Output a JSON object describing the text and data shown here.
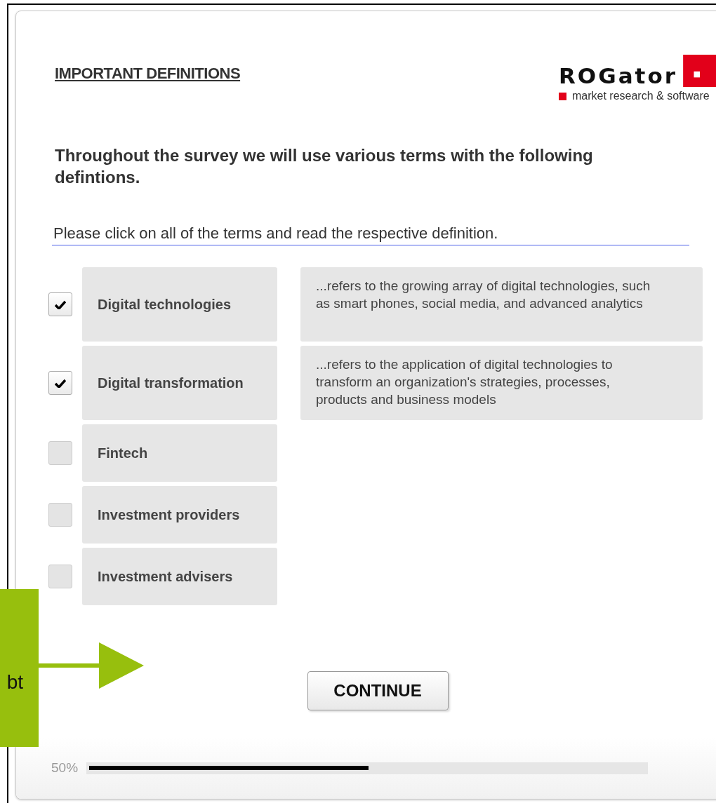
{
  "header": {
    "title": "IMPORTANT DEFINITIONS",
    "logo": {
      "wordmark": "ROGator",
      "tagline": "market research & software"
    }
  },
  "intro": "Throughout the survey we will use various terms with the following defintions.",
  "instruction": "Please click on all of the terms and read the respective definition.",
  "terms": [
    {
      "label": "Digital technologies",
      "checked": true,
      "definition": "...refers to the growing array of digital technologies, such as smart phones, social media, and advanced analytics"
    },
    {
      "label": "Digital transformation",
      "checked": true,
      "definition": "...refers to the application of digital technologies to transform an organization's strategies, processes, products and business models"
    },
    {
      "label": "Fintech",
      "checked": false
    },
    {
      "label": "Investment providers",
      "checked": false
    },
    {
      "label": "Investment advisers",
      "checked": false
    }
  ],
  "continue_button": "CONTINUE",
  "progress": {
    "reading": "50%",
    "level": 0.5
  },
  "callout": {
    "text": "bt"
  }
}
